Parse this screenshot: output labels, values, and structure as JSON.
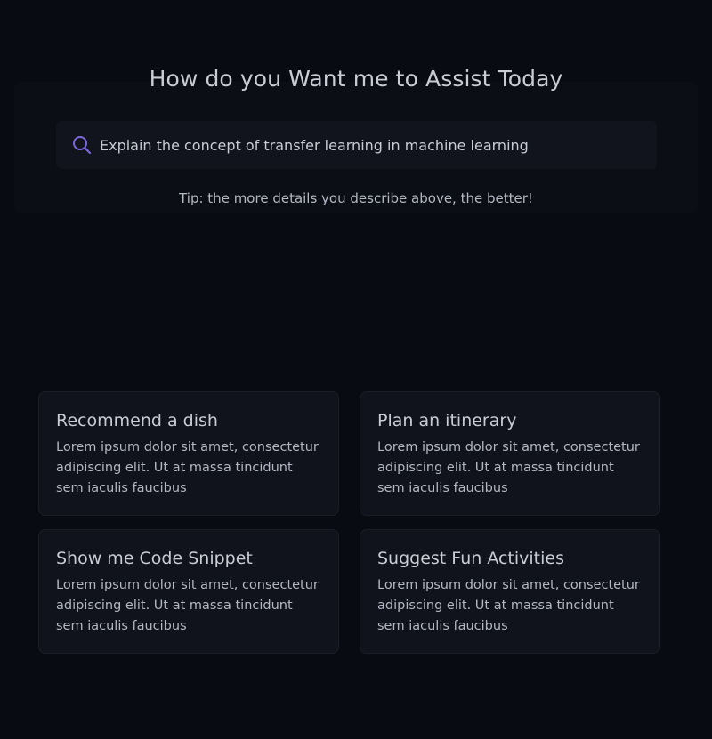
{
  "header": {
    "title": "How do you Want me to Assist Today"
  },
  "search": {
    "value": "Explain the concept of transfer learning in machine learning",
    "icon": "search-icon",
    "icon_color": "#7b67d9"
  },
  "tip": "Tip: the more details you describe above, the better!",
  "cards": [
    {
      "title": "Recommend a dish",
      "description": "Lorem ipsum dolor sit amet, consectetur adipiscing elit. Ut at massa tincidunt sem iaculis faucibus"
    },
    {
      "title": "Plan an itinerary",
      "description": "Lorem ipsum dolor sit amet, consectetur adipiscing elit. Ut at massa tincidunt sem iaculis faucibus"
    },
    {
      "title": "Show me Code Snippet",
      "description": "Lorem ipsum dolor sit amet, consectetur adipiscing elit. Ut at massa tincidunt sem iaculis faucibus"
    },
    {
      "title": "Suggest Fun Activities",
      "description": "Lorem ipsum dolor sit amet, consectetur adipiscing elit. Ut at massa tincidunt sem iaculis faucibus"
    }
  ]
}
